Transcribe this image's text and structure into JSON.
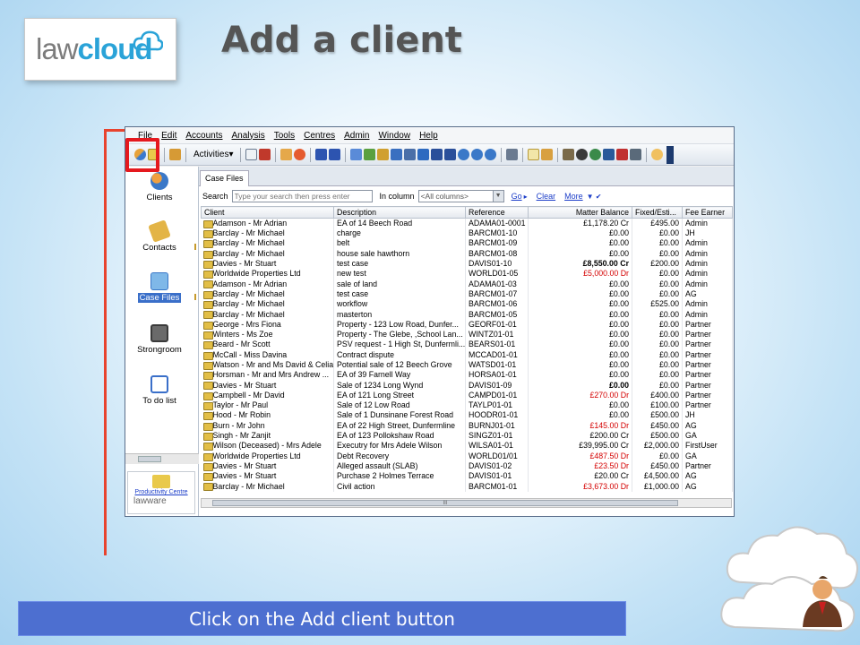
{
  "slide": {
    "title": "Add a client",
    "logo_prefix": "law",
    "logo_suffix": "cloud",
    "instruction": "Click on the Add client button"
  },
  "app": {
    "menu": [
      "File",
      "Edit",
      "Accounts",
      "Analysis",
      "Tools",
      "Centres",
      "Admin",
      "Window",
      "Help"
    ],
    "toolbar": {
      "activities_label": "Activities"
    },
    "sidebar": {
      "items": [
        {
          "label": "Clients",
          "icon": "clients-icon"
        },
        {
          "label": "Contacts",
          "icon": "contacts-icon"
        },
        {
          "label": "Case Files",
          "icon": "case-files-icon",
          "active": true
        },
        {
          "label": "Strongroom",
          "icon": "strongroom-icon"
        },
        {
          "label": "To do list",
          "icon": "todo-list-icon"
        }
      ],
      "productivity_label": "Productivity Centre",
      "brand": "lawware"
    },
    "tab_label": "Case Files",
    "search": {
      "label": "Search",
      "placeholder": "Type your search then press enter",
      "in_column_label": "In column",
      "column_value": "<All columns>",
      "go_label": "Go",
      "clear_label": "Clear",
      "more_label": "More"
    },
    "columns": [
      "Client",
      "Description",
      "Reference",
      "Matter Balance",
      "Fixed/Esti...",
      "Fee Earner"
    ],
    "rows": [
      [
        "Adamson - Mr Adrian",
        "EA of 14 Beech Road",
        "ADAMA01-0001",
        "£1,178.20 Cr",
        "£495.00",
        "Admin"
      ],
      [
        "Barclay - Mr Michael",
        "charge",
        "BARCM01-10",
        "£0.00",
        "£0.00",
        "JH"
      ],
      [
        "Barclay - Mr Michael",
        "belt",
        "BARCM01-09",
        "£0.00",
        "£0.00",
        "Admin"
      ],
      [
        "Barclay - Mr Michael",
        "house sale hawthorn",
        "BARCM01-08",
        "£0.00",
        "£0.00",
        "Admin"
      ],
      [
        "Davies - Mr Stuart",
        "test case",
        "DAVIS01-10",
        "£8,550.00 Cr",
        "£200.00",
        "Admin"
      ],
      [
        "Worldwide Properties Ltd",
        "new test",
        "WORLD01-05",
        "£5,000.00 Dr",
        "£0.00",
        "Admin"
      ],
      [
        "Adamson - Mr Adrian",
        "sale of land",
        "ADAMA01-03",
        "£0.00",
        "£0.00",
        "Admin"
      ],
      [
        "Barclay - Mr Michael",
        "test case",
        "BARCM01-07",
        "£0.00",
        "£0.00",
        "AG"
      ],
      [
        "Barclay - Mr Michael",
        "workflow",
        "BARCM01-06",
        "£0.00",
        "£525.00",
        "Admin"
      ],
      [
        "Barclay - Mr Michael",
        "masterton",
        "BARCM01-05",
        "£0.00",
        "£0.00",
        "Admin"
      ],
      [
        "George - Mrs Fiona",
        "Property - 123 Low Road, Dunfer...",
        "GEORF01-01",
        "£0.00",
        "£0.00",
        "Partner"
      ],
      [
        "Winters - Ms Zoe",
        "Property - The Glebe, ,School Lan...",
        "WINTZ01-01",
        "£0.00",
        "£0.00",
        "Partner"
      ],
      [
        "Beard - Mr Scott",
        "PSV request - 1 High St, Dunfermli...",
        "BEARS01-01",
        "£0.00",
        "£0.00",
        "Partner"
      ],
      [
        "McCall - Miss Davina",
        "Contract dispute",
        "MCCAD01-01",
        "£0.00",
        "£0.00",
        "Partner"
      ],
      [
        "Watson - Mr and Ms David & Celia",
        "Potential sale of 12 Beech Grove",
        "WATSD01-01",
        "£0.00",
        "£0.00",
        "Partner"
      ],
      [
        "Horsman - Mr and Mrs Andrew ...",
        "EA of 39 Farnell Way",
        "HORSA01-01",
        "£0.00",
        "£0.00",
        "Partner"
      ],
      [
        "Davies - Mr Stuart",
        "Sale of 1234 Long Wynd",
        "DAVIS01-09",
        "£0.00",
        "£0.00",
        "Partner"
      ],
      [
        "Campbell - Mr David",
        "EA of 121 Long Street",
        "CAMPD01-01",
        "£270.00 Dr",
        "£400.00",
        "Partner"
      ],
      [
        "Taylor - Mr Paul",
        "Sale of 12 Low Road",
        "TAYLP01-01",
        "£0.00",
        "£100.00",
        "Partner"
      ],
      [
        "Hood - Mr Robin",
        "Sale of 1 Dunsinane Forest Road",
        "HOODR01-01",
        "£0.00",
        "£500.00",
        "JH"
      ],
      [
        "Burn - Mr John",
        "EA of 22 High Street, Dunfermline",
        "BURNJ01-01",
        "£145.00 Dr",
        "£450.00",
        "AG"
      ],
      [
        "Singh - Mr Zanjit",
        "EA of 123 Pollokshaw Road",
        "SINGZ01-01",
        "£200.00 Cr",
        "£500.00",
        "GA"
      ],
      [
        "Wilson (Deceased) - Mrs Adele",
        "Executry for Mrs Adele Wilson",
        "WILSA01-01",
        "£39,995.00 Cr",
        "£2,000.00",
        "FirstUser"
      ],
      [
        "Worldwide Properties Ltd",
        "Debt Recovery",
        "WORLD01/01",
        "£487.50 Dr",
        "£0.00",
        "GA"
      ],
      [
        "Davies - Mr Stuart",
        "Alleged assault (SLAB)",
        "DAVIS01-02",
        "£23.50 Dr",
        "£450.00",
        "Partner"
      ],
      [
        "Davies - Mr Stuart",
        "Purchase 2 Holmes Terrace",
        "DAVIS01-01",
        "£20.00 Cr",
        "£4,500.00",
        "AG"
      ],
      [
        "Barclay - Mr Michael",
        "Civil action",
        "BARCM01-01",
        "£3,673.00 Dr",
        "£1,000.00",
        "AG"
      ]
    ],
    "scroll_grip": "III"
  },
  "colors": {
    "accent": "#4d6fd0",
    "highlight": "#e5191e",
    "debit": "#d40000"
  }
}
